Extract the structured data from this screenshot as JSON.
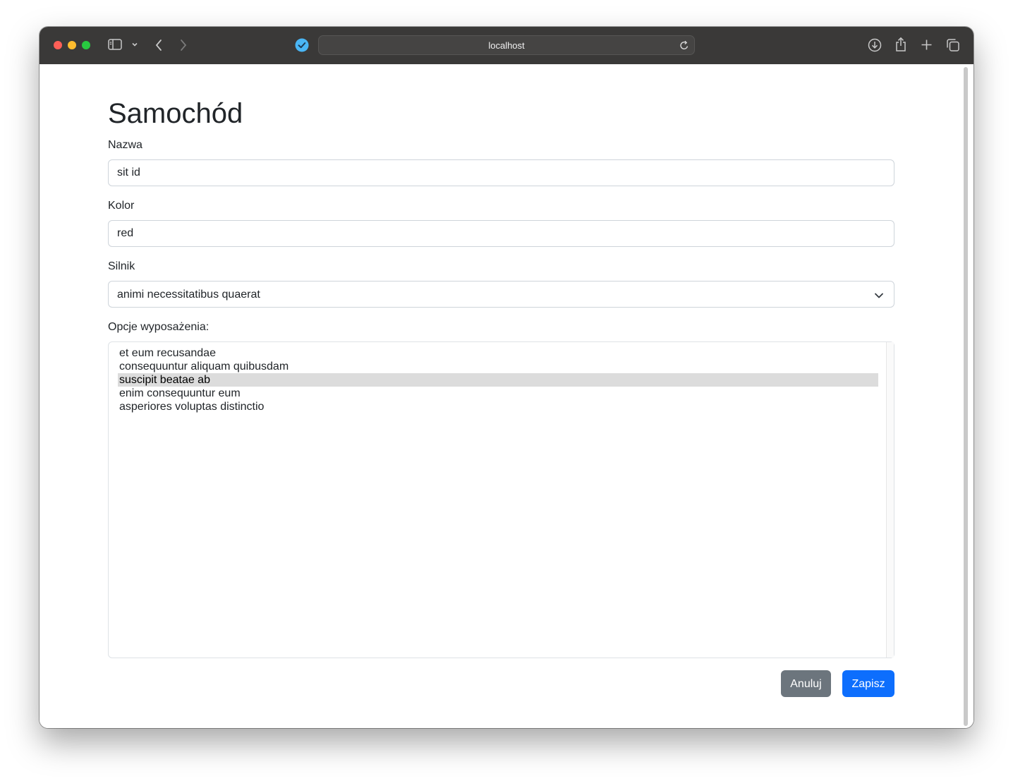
{
  "browser": {
    "url": "localhost",
    "colors": {
      "close": "#ff5f57",
      "minimize": "#febc2e",
      "maximize": "#28c840",
      "shield": "#4ab6f5"
    },
    "icons": [
      "sidebar-icon",
      "chevron-down-icon",
      "back-icon",
      "forward-icon",
      "privacy-shield-icon",
      "reload-icon",
      "download-icon",
      "share-icon",
      "new-tab-icon",
      "tab-overview-icon"
    ]
  },
  "form": {
    "title": "Samochód",
    "name_label": "Nazwa",
    "name_value": "sit id",
    "color_label": "Kolor",
    "color_value": "red",
    "engine_label": "Silnik",
    "engine_value": "animi necessitatibus quaerat",
    "options_label": "Opcje wyposażenia:",
    "options": [
      {
        "label": "et eum recusandae",
        "selected": false
      },
      {
        "label": "consequuntur aliquam quibusdam",
        "selected": false
      },
      {
        "label": "suscipit beatae ab",
        "selected": true
      },
      {
        "label": "enim consequuntur eum",
        "selected": false
      },
      {
        "label": "asperiores voluptas distinctio",
        "selected": false
      }
    ],
    "cancel_label": "Anuluj",
    "save_label": "Zapisz",
    "colors": {
      "cancel": "#6c757d",
      "save": "#0d6efd"
    }
  }
}
